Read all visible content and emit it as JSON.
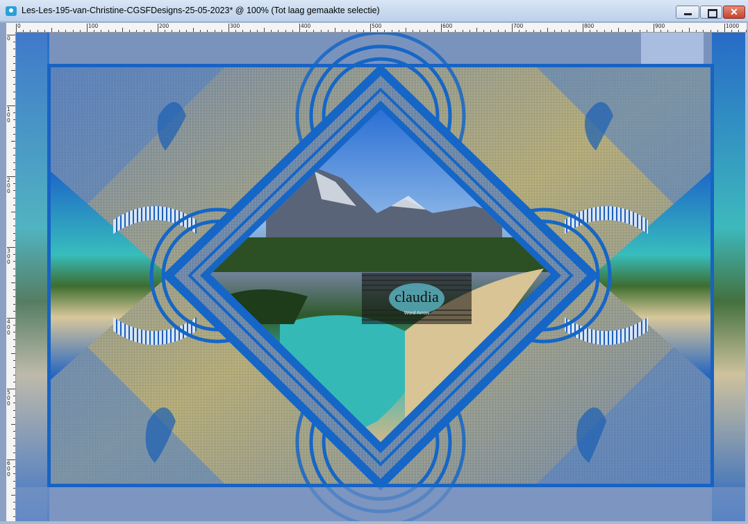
{
  "window": {
    "title": "Les-Les-195-van-Christine-CGSFDesigns-25-05-2023* @ 100% (Tot laag gemaakte selectie)"
  },
  "ruler": {
    "h_labels": [
      "0",
      "100",
      "200",
      "300",
      "400",
      "500",
      "600",
      "700",
      "800",
      "900",
      "1000"
    ],
    "v_labels": [
      "0",
      "100",
      "200",
      "300",
      "400",
      "500",
      "600"
    ]
  },
  "artwork": {
    "watermark_text": "claudia",
    "watermark_subtext": "Word Arrow"
  },
  "colors": {
    "accent_blue": "#1566c6",
    "frame_light": "#a9bde0",
    "titlebar": "#c7d8ee"
  }
}
